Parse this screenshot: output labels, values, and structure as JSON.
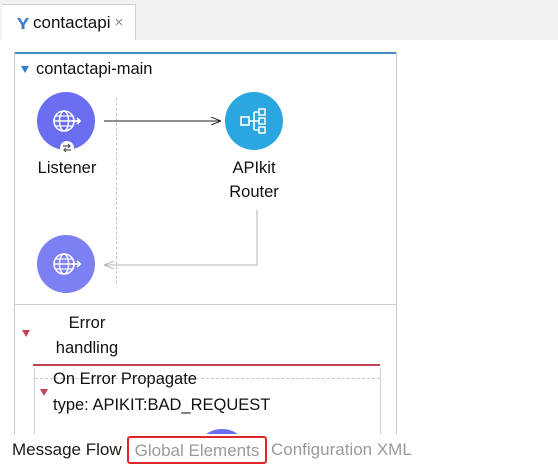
{
  "editor": {
    "tab_label": "contactapi",
    "tab_close": "×",
    "tab_icon": "mule-icon",
    "accent": "#4a8cc8"
  },
  "flow": {
    "name": "contactapi-main",
    "nodes": [
      {
        "id": "listener",
        "label": "Listener",
        "icon": "globe-arrow-icon",
        "color": "#6b6ef0"
      },
      {
        "id": "apikit",
        "label_lines": [
          "APIkit",
          "Router"
        ],
        "icon": "router-icon",
        "color": "#2aa7e0"
      },
      {
        "id": "response",
        "label": "",
        "icon": "globe-arrow-icon",
        "color": "#7d80f2"
      }
    ]
  },
  "error_handling": {
    "title_lines": [
      "Error",
      "handling"
    ],
    "accent": "#c0455a",
    "handler": {
      "title": "On Error Propagate",
      "type_text": "type: APIKIT:BAD_REQUEST"
    }
  },
  "bottom_tabs": [
    {
      "label": "Message Flow",
      "active": true
    },
    {
      "label": "Global Elements",
      "active": false,
      "highlighted": true,
      "highlight_color": "#e0262b"
    },
    {
      "label": "Configuration XML",
      "active": false
    }
  ]
}
